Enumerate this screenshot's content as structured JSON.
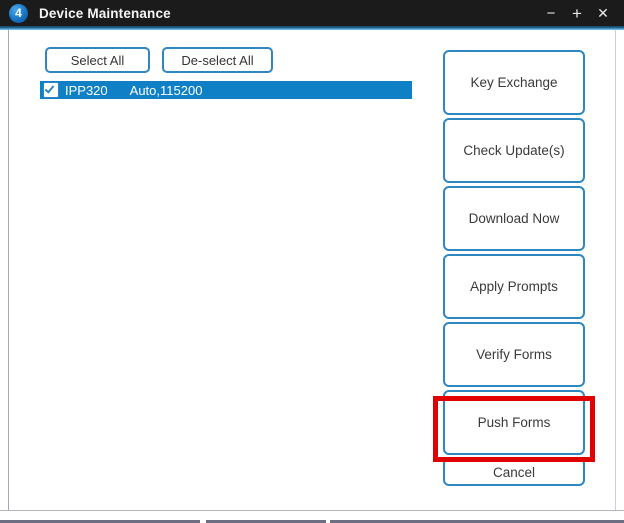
{
  "window": {
    "title": "Device Maintenance",
    "icon_badge": "4",
    "icon_name": "app-badge-icon",
    "controls": {
      "minimize": "−",
      "maximize": "+",
      "close": "✕"
    }
  },
  "toolbar": {
    "select_all_label": "Select All",
    "deselect_all_label": "De-select All"
  },
  "device_list": {
    "rows": [
      {
        "checked": true,
        "name": "IPP320",
        "connection": "Auto,115200",
        "selected": true
      }
    ]
  },
  "actions": {
    "buttons": [
      {
        "label": "Key Exchange",
        "highlighted": false
      },
      {
        "label": "Check Update(s)",
        "highlighted": false
      },
      {
        "label": "Download Now",
        "highlighted": false
      },
      {
        "label": "Apply Prompts",
        "highlighted": false
      },
      {
        "label": "Verify Forms",
        "highlighted": false
      },
      {
        "label": "Push Forms",
        "highlighted": true
      },
      {
        "label": "Cancel",
        "highlighted": false
      }
    ]
  },
  "colors": {
    "titlebar_bg": "#1b1b1b",
    "accent_blue": "#2e87c0",
    "selection_blue": "#1080c6",
    "highlight_red": "#e00000",
    "panel_bg": "#ffffff"
  }
}
